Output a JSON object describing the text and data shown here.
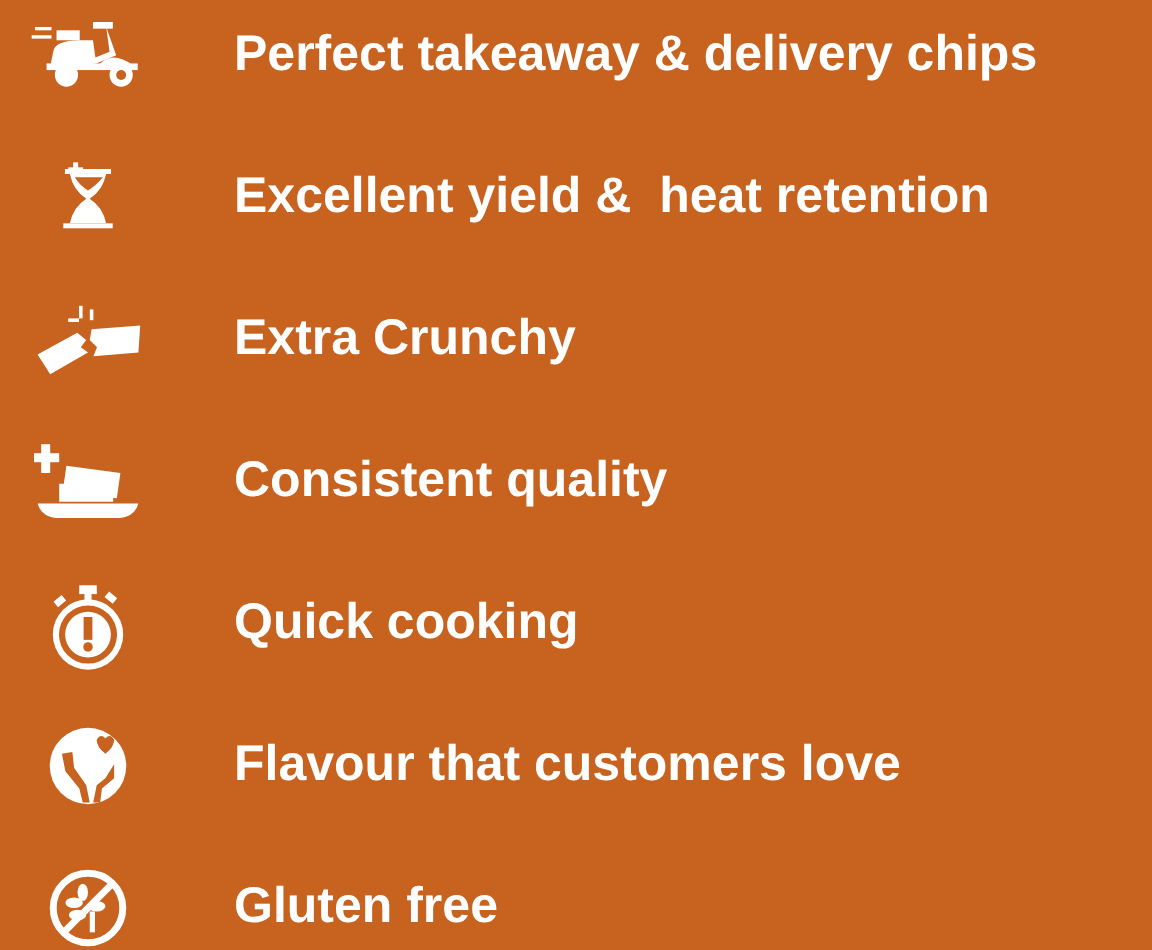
{
  "features": [
    {
      "text": "Perfect takeaway & delivery chips"
    },
    {
      "text": "Excellent yield &  heat retention"
    },
    {
      "text": "Extra Crunchy"
    },
    {
      "text": "Consistent quality"
    },
    {
      "text": "Quick cooking"
    },
    {
      "text": "Flavour that customers love"
    },
    {
      "text": "Gluten free"
    }
  ]
}
